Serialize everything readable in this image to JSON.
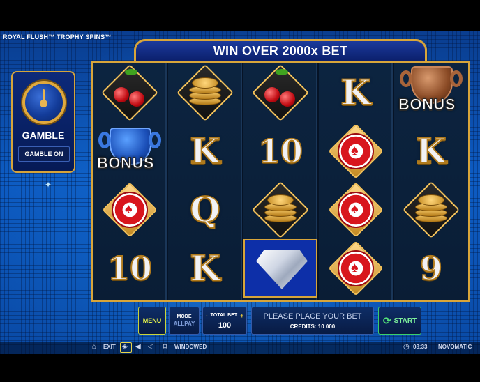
{
  "game": {
    "title": "ROYAL FLUSH™ TROPHY SPINS™",
    "win_banner": "WIN OVER 2000x BET"
  },
  "gamble": {
    "label": "GAMBLE",
    "toggle": "GAMBLE ON"
  },
  "reels": {
    "columns": [
      [
        "cherries",
        "bonus-trophy-blue",
        "chip",
        "10"
      ],
      [
        "coins",
        "K",
        "Q",
        "K"
      ],
      [
        "cherries",
        "10",
        "coins",
        "diamond"
      ],
      [
        "K",
        "chip",
        "chip",
        "chip"
      ],
      [
        "bonus-trophy-bronze",
        "K",
        "coins",
        "9"
      ]
    ],
    "bonus_text": "BONUS"
  },
  "controls": {
    "menu": "MENU",
    "mode_label": "MODE",
    "mode_value": "ALLPAY",
    "bet_label": "TOTAL BET",
    "bet_minus": "-",
    "bet_plus": "+",
    "bet_value": "100",
    "message": "PLEASE PLACE YOUR BET",
    "credits": "CREDITS: 10 000",
    "start": "START"
  },
  "statusbar": {
    "exit": "EXIT",
    "windowed": "WINDOWED",
    "clock": "08:33",
    "brand": "NOVOMATIC"
  },
  "colors": {
    "gold": "#d8a53a",
    "menu_accent": "#e4f04a",
    "start_accent": "#53e07a"
  }
}
